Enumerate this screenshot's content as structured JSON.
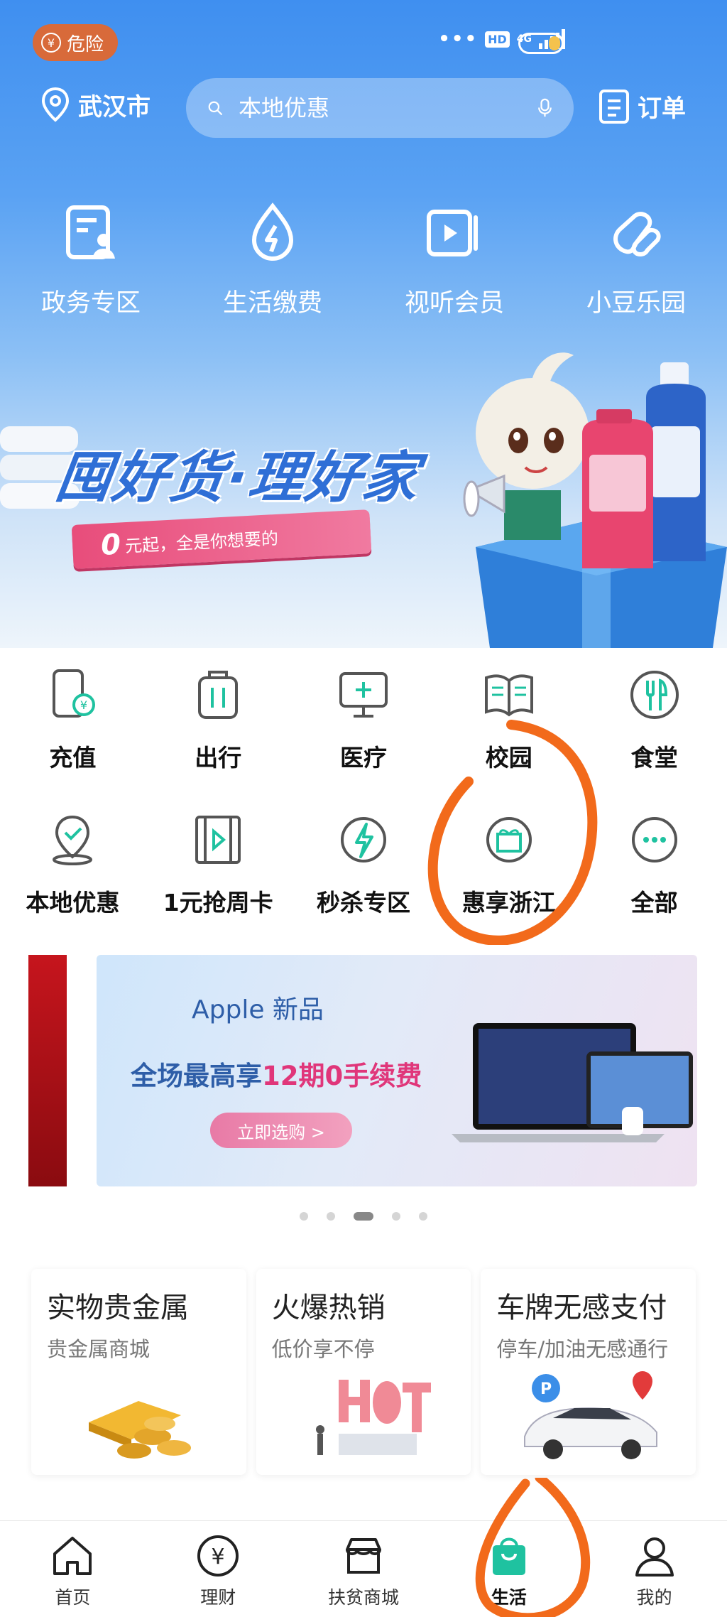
{
  "status": {
    "risk_label": "危险",
    "network": "4G"
  },
  "top": {
    "city": "武汉市",
    "search_placeholder": "本地优惠",
    "orders_label": "订单"
  },
  "quick_services": [
    {
      "label": "政务专区",
      "icon": "document-person-icon"
    },
    {
      "label": "生活缴费",
      "icon": "drop-bolt-icon"
    },
    {
      "label": "视听会员",
      "icon": "video-play-icon"
    },
    {
      "label": "小豆乐园",
      "icon": "bean-icon"
    }
  ],
  "hero_banner": {
    "title": "囤好货·理好家",
    "ribbon_zero": "0",
    "ribbon_text": "元起，全是你想要的"
  },
  "services_row1": [
    {
      "label": "充值",
      "icon": "phone-yuan-icon"
    },
    {
      "label": "出行",
      "icon": "luggage-icon"
    },
    {
      "label": "医疗",
      "icon": "monitor-cross-icon"
    },
    {
      "label": "校园",
      "icon": "book-icon"
    },
    {
      "label": "食堂",
      "icon": "cutlery-icon"
    }
  ],
  "services_row2": [
    {
      "label": "本地优惠",
      "icon": "location-check-icon"
    },
    {
      "label": "1元抢周卡",
      "icon": "film-play-icon"
    },
    {
      "label": "秒杀专区",
      "icon": "lightning-circle-icon"
    },
    {
      "label": "惠享浙江",
      "icon": "gift-icon"
    },
    {
      "label": "全部",
      "icon": "more-dots-icon"
    }
  ],
  "promo": {
    "line1": "Apple 新品",
    "line2_a": "全场最高享",
    "line2_b": "12期0手续费",
    "button": "立即选购 >"
  },
  "cards": [
    {
      "title": "实物贵金属",
      "subtitle": "贵金属商城"
    },
    {
      "title": "火爆热销",
      "subtitle": "低价享不停"
    },
    {
      "title": "车牌无感支付",
      "subtitle": "停车/加油无感通行"
    }
  ],
  "tabs": [
    {
      "label": "首页",
      "icon": "home-icon"
    },
    {
      "label": "理财",
      "icon": "yuan-circle-icon"
    },
    {
      "label": "扶贫商城",
      "icon": "shop-icon"
    },
    {
      "label": "生活",
      "icon": "shopping-bag-icon"
    },
    {
      "label": "我的",
      "icon": "person-icon"
    }
  ],
  "colors": {
    "accent": "#1fc2a0",
    "hero": "#4a96f1",
    "annotation": "#f26a1b"
  }
}
